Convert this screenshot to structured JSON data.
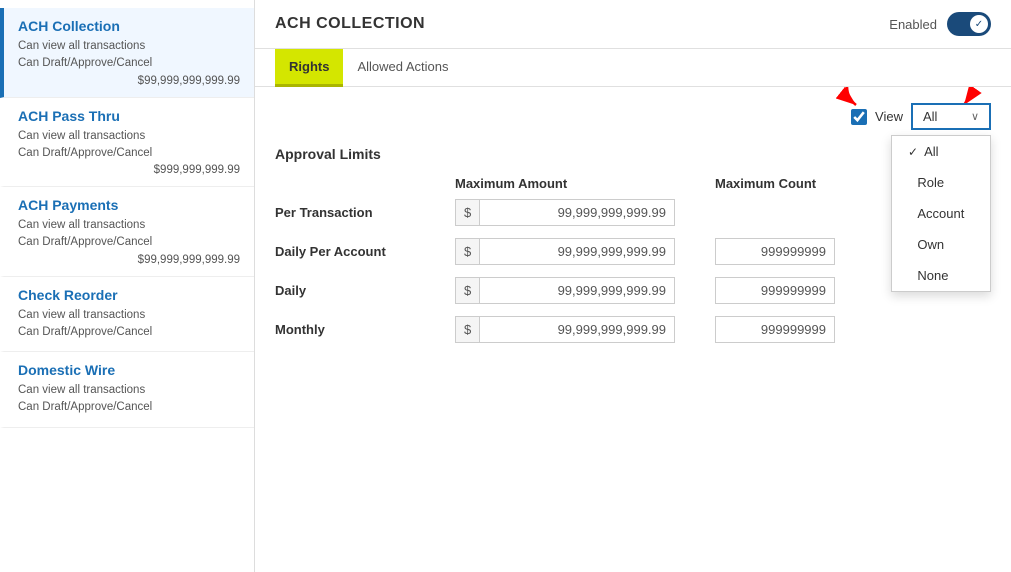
{
  "sidebar": {
    "items": [
      {
        "id": "ach-collection",
        "title": "ACH Collection",
        "sub1": "Can view all transactions",
        "sub2": "Can Draft/Approve/Cancel",
        "amount": "$99,999,999,999.99",
        "active": true
      },
      {
        "id": "ach-pass-thru",
        "title": "ACH Pass Thru",
        "sub1": "Can view all transactions",
        "sub2": "Can Draft/Approve/Cancel",
        "amount": "$999,999,999.99",
        "active": false
      },
      {
        "id": "ach-payments",
        "title": "ACH Payments",
        "sub1": "Can view all transactions",
        "sub2": "Can Draft/Approve/Cancel",
        "amount": "$99,999,999,999.99",
        "active": false
      },
      {
        "id": "check-reorder",
        "title": "Check Reorder",
        "sub1": "Can view all transactions",
        "sub2": "Can Draft/Approve/Cancel",
        "amount": "",
        "active": false
      },
      {
        "id": "domestic-wire",
        "title": "Domestic Wire",
        "sub1": "Can view all transactions",
        "sub2": "Can Draft/Approve/Cancel",
        "amount": "",
        "active": false
      }
    ]
  },
  "header": {
    "title": "ACH COLLECTION",
    "enabled_label": "Enabled",
    "toggle_on": true
  },
  "tabs": [
    {
      "id": "rights",
      "label": "Rights",
      "active": true
    },
    {
      "id": "allowed-actions",
      "label": "Allowed Actions",
      "active": false
    }
  ],
  "view_row": {
    "checkbox_checked": true,
    "view_label": "View",
    "dropdown_selected": "All"
  },
  "dropdown": {
    "items": [
      {
        "id": "all",
        "label": "All",
        "selected": true
      },
      {
        "id": "role",
        "label": "Role",
        "selected": false
      },
      {
        "id": "account",
        "label": "Account",
        "selected": false
      },
      {
        "id": "own",
        "label": "Own",
        "selected": false
      },
      {
        "id": "none",
        "label": "None",
        "selected": false
      }
    ]
  },
  "approval_limits": {
    "section_title": "Approval Limits",
    "col_headers": [
      "",
      "Maximum Amount",
      "Maximum Count"
    ],
    "rows": [
      {
        "label": "Per Transaction",
        "amount": "99,999,999,999.99",
        "count": ""
      },
      {
        "label": "Daily Per Account",
        "amount": "99,999,999,999.99",
        "count": "999999999"
      },
      {
        "label": "Daily",
        "amount": "99,999,999,999.99",
        "count": "999999999"
      },
      {
        "label": "Monthly",
        "amount": "99,999,999,999.99",
        "count": "999999999"
      }
    ],
    "currency_symbol": "$"
  }
}
